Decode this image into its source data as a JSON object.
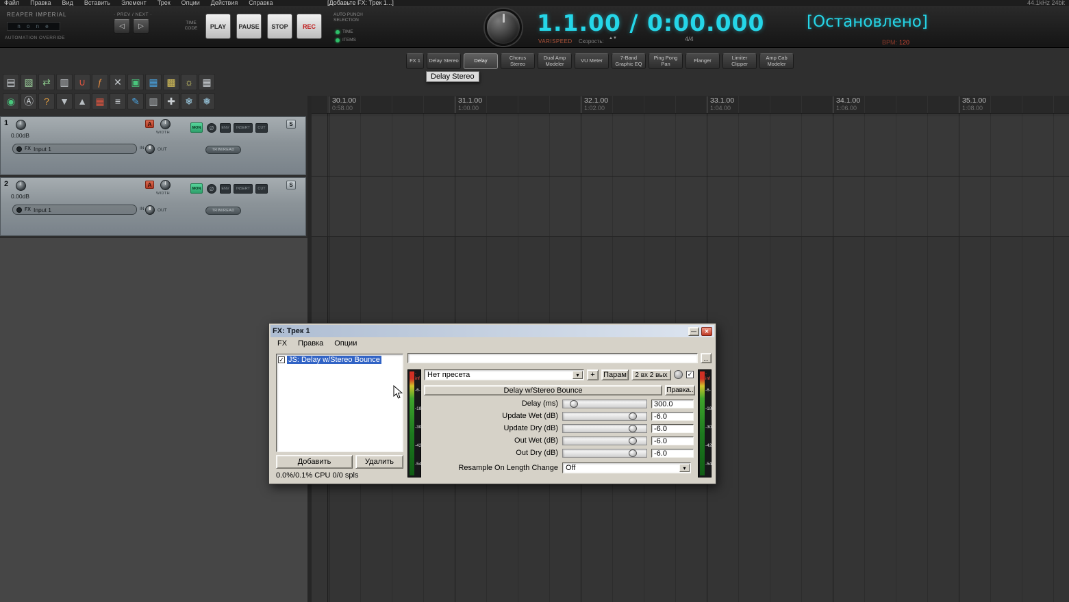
{
  "colors": {
    "accent_cyan": "#25d6e8",
    "rec_red": "#c01818",
    "mon_green": "#2da06b",
    "selection_blue": "#3163c5"
  },
  "menubar": {
    "items": [
      "Файл",
      "Правка",
      "Вид",
      "Вставить",
      "Элемент",
      "Трек",
      "Опции",
      "Действия",
      "Справка"
    ],
    "center_title": "[Добавьте FX: Трек 1...]",
    "right_info": "44.1kHz 24bit"
  },
  "transport": {
    "theme_label": "REAPER IMPERIAL",
    "lcd_value": "n o n e",
    "automation_label": "AUTOMATION OVERRIDE",
    "prev_next_label": "· PREV / NEXT ·",
    "prev_glyph": "◁",
    "next_glyph": "▷",
    "timecode_label": "TIME CODE",
    "play_label": "PLAY",
    "pause_label": "PAUSE",
    "stop_label": "STOP",
    "rec_label": "REC",
    "auto_punch_label": "AUTO PUNCH SELECTION",
    "time_label": "TIME",
    "items_label": "ITEMS",
    "position_display": "1.1.00 / 0:00.000",
    "varispeed_label": "VARISPEED",
    "speed_label": "Скорость:",
    "spinner_glyphs": "▲▼",
    "time_signature": "4/4",
    "bpm_label": "BPM:",
    "bpm_value": "120",
    "status": "[Остановлено]"
  },
  "fx_bar": {
    "buttons": [
      "FX 1",
      "Delay Stereo",
      "Delay",
      "Chorus Stereo",
      "Dual Amp Modeler",
      "VU Meter",
      "7-Band Graphic EQ",
      "Ping Pong Pan",
      "Flanger",
      "Limiter Clipper",
      "Amp Cab Modeler"
    ],
    "active_index": 2,
    "tooltip": "Delay Stereo"
  },
  "toolbar": {
    "row1": [
      {
        "name": "new-project-icon",
        "glyph": "▤",
        "color": "#cfd4d8"
      },
      {
        "name": "open-project-icon",
        "glyph": "▧",
        "color": "#9fd49f"
      },
      {
        "name": "save-project-icon",
        "glyph": "⇄",
        "color": "#8fcf8f"
      },
      {
        "name": "render-icon",
        "glyph": "▥",
        "color": "#c9ced2"
      },
      {
        "name": "snap-magnet-icon",
        "glyph": "∪",
        "color": "#e05540"
      },
      {
        "name": "envelope-icon",
        "glyph": "ƒ",
        "color": "#e08a40"
      },
      {
        "name": "crossfade-icon",
        "glyph": "✕",
        "color": "#c9ced2"
      },
      {
        "name": "media-explorer-icon",
        "glyph": "▣",
        "color": "#49c67c"
      },
      {
        "name": "mixer-icon",
        "glyph": "▦",
        "color": "#4aa3e0"
      },
      {
        "name": "grid-icon",
        "glyph": "▩",
        "color": "#d8c25a"
      },
      {
        "name": "brightness-icon",
        "glyph": "☼",
        "color": "#e8e070"
      },
      {
        "name": "matrix-icon",
        "glyph": "▦",
        "color": "#cfd4d8"
      }
    ],
    "row2": [
      {
        "name": "monitor-fx-icon",
        "glyph": "◉",
        "color": "#49c67c"
      },
      {
        "name": "lock-icon",
        "glyph": "Ⓐ",
        "color": "#cfd4d8"
      },
      {
        "name": "help-icon",
        "glyph": "?",
        "color": "#e8a040"
      },
      {
        "name": "collapse-tracks-icon",
        "glyph": "▼",
        "color": "#b8bec2"
      },
      {
        "name": "expand-tracks-icon",
        "glyph": "▲",
        "color": "#b8bec2"
      },
      {
        "name": "color-palette-icon",
        "glyph": "▦",
        "color": "#e05540"
      },
      {
        "name": "track-list-icon",
        "glyph": "≡",
        "color": "#cfd4d8"
      },
      {
        "name": "edit-pencil-icon",
        "glyph": "✎",
        "color": "#4aa3e0"
      },
      {
        "name": "meter-icon",
        "glyph": "▥",
        "color": "#b8bec2"
      },
      {
        "name": "tools-icon",
        "glyph": "✚",
        "color": "#c9ced2"
      },
      {
        "name": "freeze-icon",
        "glyph": "❄",
        "color": "#9fd0e8"
      },
      {
        "name": "freeze-alt-icon",
        "glyph": "❅",
        "color": "#9fd0e8"
      }
    ]
  },
  "ruler": {
    "marks": [
      {
        "bar": "30.1.00",
        "time": "0:58.00"
      },
      {
        "bar": "31.1.00",
        "time": "1:00.00"
      },
      {
        "bar": "32.1.00",
        "time": "1:02.00"
      },
      {
        "bar": "33.1.00",
        "time": "1:04.00"
      },
      {
        "bar": "34.1.00",
        "time": "1:06.00"
      },
      {
        "bar": "35.1.00",
        "time": "1:08.00"
      }
    ]
  },
  "tracks": [
    {
      "number": "1",
      "volume": "0.00dB",
      "fx_label": "FX",
      "input_name": "Input 1",
      "in_label": "IN",
      "a_label": "A",
      "width_label": "WIDTH",
      "out_label": "OUT",
      "mon_label": "MON",
      "phase_label": "Ø",
      "env_label": "ENV",
      "insert_label": "INSERT",
      "cut_label": "CUT",
      "solo_label": "S",
      "trim_label": "TRIM/READ"
    },
    {
      "number": "2",
      "volume": "0.00dB",
      "fx_label": "FX",
      "input_name": "Input 1",
      "in_label": "IN",
      "a_label": "A",
      "width_label": "WIDTH",
      "out_label": "OUT",
      "mon_label": "MON",
      "phase_label": "Ø",
      "env_label": "ENV",
      "insert_label": "INSERT",
      "cut_label": "CUT",
      "solo_label": "S",
      "trim_label": "TRIM/READ"
    }
  ],
  "fx_dialog": {
    "title": "FX: Трек 1",
    "min_glyph": "—",
    "close_glyph": "✕",
    "menu": [
      "FX",
      "Правка",
      "Опции"
    ],
    "chain": [
      {
        "label": "JS: Delay w/Stereo Bounce",
        "checked": true,
        "selected": true
      }
    ],
    "add_label": "Добавить",
    "delete_label": "Удалить",
    "cpu_status": "0.0%/0.1% CPU 0/0 spls",
    "dots_label": "...",
    "preset_value": "Нет пресета",
    "plus_label": "+",
    "param_label": "Парам",
    "io_label": "2 вх 2 вых",
    "plugin_title": "Delay w/Stereo Bounce",
    "edit_label": "Правка..",
    "sliders": [
      {
        "label": "Delay (ms)",
        "value": "300.0",
        "pos": 0.09
      },
      {
        "label": "Update Wet (dB)",
        "value": "-6.0",
        "pos": 0.87
      },
      {
        "label": "Update Dry (dB)",
        "value": "-6.0",
        "pos": 0.87
      },
      {
        "label": "Out Wet (dB)",
        "value": "-6.0",
        "pos": 0.87
      },
      {
        "label": "Out Dry (dB)",
        "value": "-6.0",
        "pos": 0.87
      }
    ],
    "resample_label": "Resample On Length Change",
    "resample_value": "Off",
    "meter_labels": [
      {
        "text": "-inf",
        "color": "#ff5544"
      },
      {
        "text": "-6-",
        "color": "#e2e2e2"
      },
      {
        "text": "-18-",
        "color": "#e2e2e2"
      },
      {
        "text": "-30-",
        "color": "#e2e2e2"
      },
      {
        "text": "-42-",
        "color": "#e2e2e2"
      },
      {
        "text": "-54-",
        "color": "#e2e2e2"
      }
    ]
  }
}
